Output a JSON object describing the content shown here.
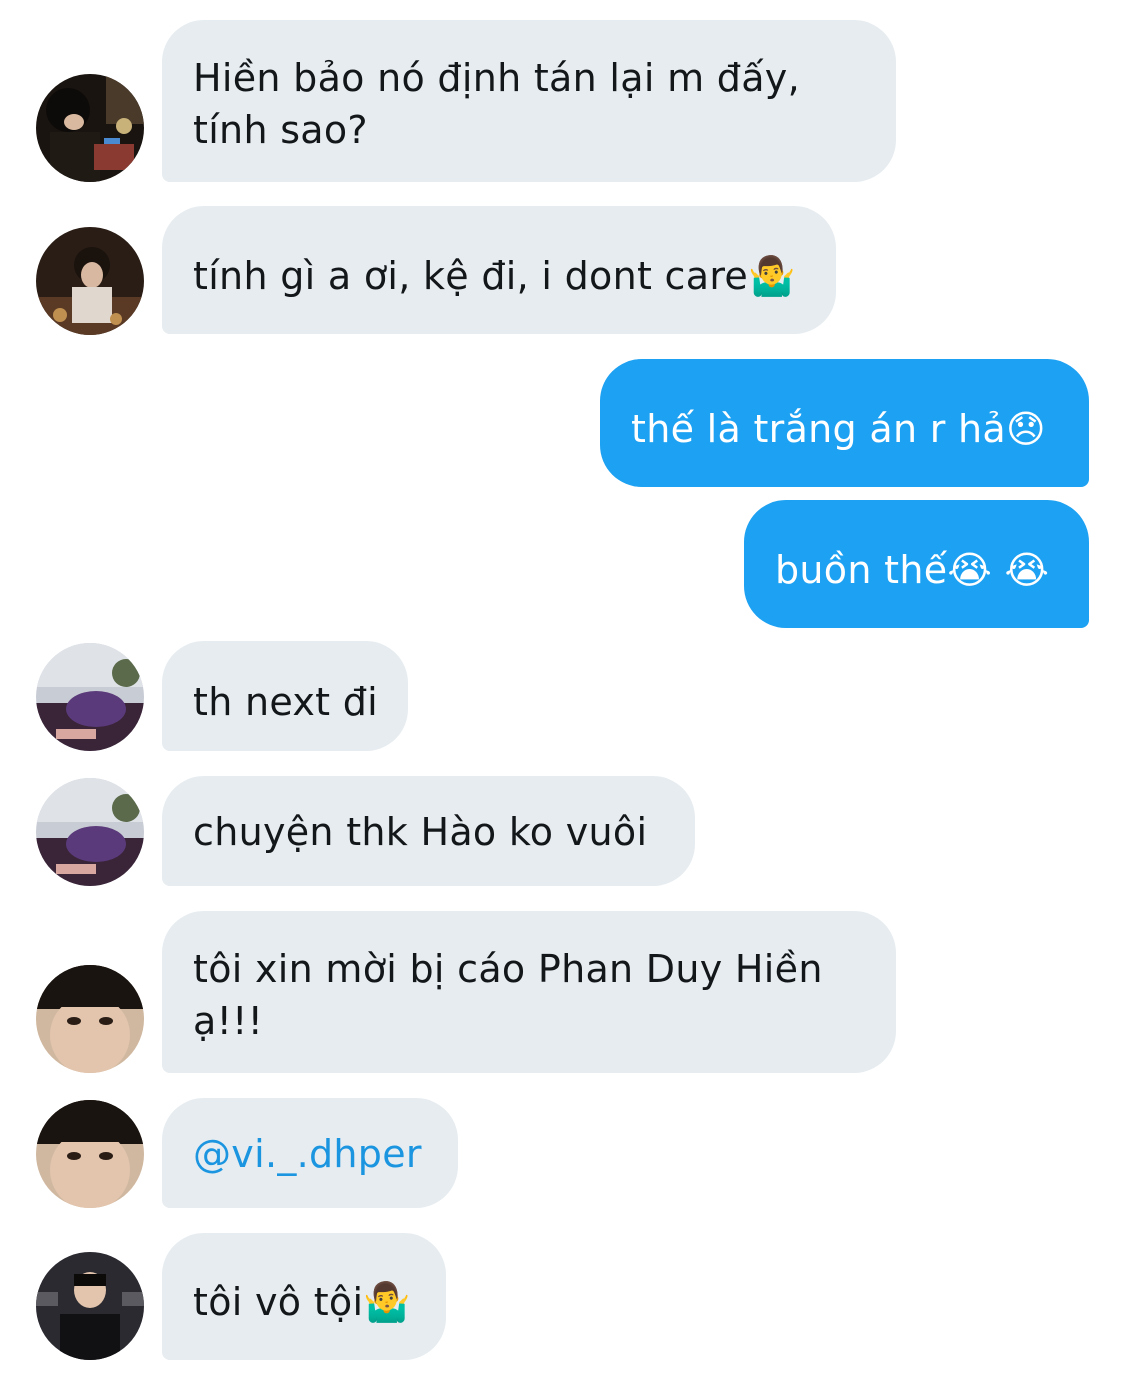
{
  "messages": [
    {
      "side": "incoming",
      "text": "Hiền bảo nó định tán lại m đấy, tính sao?",
      "lines": [
        "Hiền bảo nó định tán lại m đấy,",
        "tính sao?"
      ],
      "avatar": "avatar-dark-room-phone"
    },
    {
      "side": "incoming",
      "text": "tính gì a ơi, kệ đi, i dont care🤷‍♂️",
      "avatar": "avatar-dark-room-eating"
    },
    {
      "side": "outgoing",
      "text": "thế là trắng án r hả😞"
    },
    {
      "side": "outgoing",
      "text": "buồn thế😭 😭"
    },
    {
      "side": "incoming",
      "text": "th next đi",
      "avatar": "avatar-sleeping-purple-hoodie"
    },
    {
      "side": "incoming",
      "text": "chuyện thk Hào ko vuôi",
      "avatar": "avatar-sleeping-purple-hoodie"
    },
    {
      "side": "incoming",
      "text": "tôi xin mời bị cáo Phan Duy Hiền ạ!!!",
      "lines": [
        "tôi xin mời bị cáo Phan Duy Hiền",
        "ạ!!!"
      ],
      "avatar": "avatar-selfie-face"
    },
    {
      "side": "incoming",
      "text": "@vi._.dhper",
      "is_mention": true,
      "avatar": "avatar-selfie-face"
    },
    {
      "side": "incoming",
      "text": "tôi vô tội🤷‍♂️",
      "avatar": "avatar-sponsor-backdrop"
    }
  ],
  "colors": {
    "incoming_bubble": "#e6ecf0",
    "outgoing_bubble": "#1da1f2",
    "text": "#14171a",
    "mention": "#1b95e0"
  }
}
